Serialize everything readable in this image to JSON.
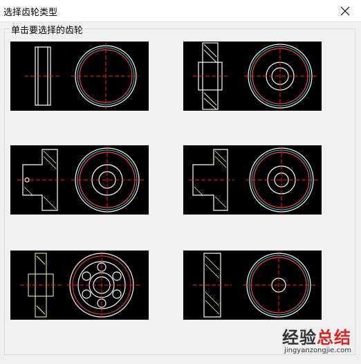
{
  "window": {
    "title": "选择齿轮类型",
    "close_icon": "close-icon"
  },
  "group": {
    "label": "单击要选择的齿轮"
  },
  "gears": [
    {
      "name": "gear-option-1"
    },
    {
      "name": "gear-option-2"
    },
    {
      "name": "gear-option-3"
    },
    {
      "name": "gear-option-4"
    },
    {
      "name": "gear-option-5"
    },
    {
      "name": "gear-option-6"
    }
  ],
  "watermark": {
    "brand_part1": "经验",
    "brand_part2": "总结",
    "url": "jingyanzongjie.com"
  },
  "colors": {
    "thumb_bg": "#000000",
    "outline": "#ffffff",
    "centerline": "#ff2020",
    "circle_accent": "#33cccc",
    "hatch": "#ffff99"
  }
}
